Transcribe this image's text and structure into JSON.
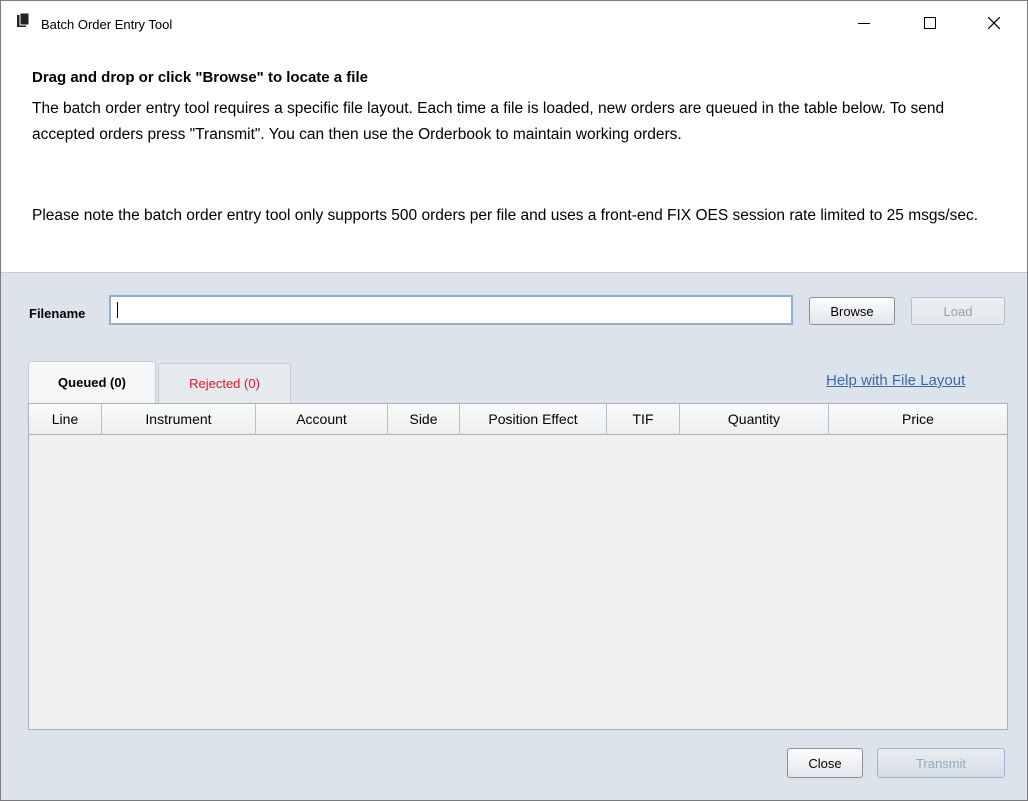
{
  "window": {
    "title": "Batch Order Entry Tool"
  },
  "intro": {
    "heading": "Drag and drop or click \"Browse\" to locate a file",
    "paragraph1": "The batch order entry tool requires a specific file layout. Each time a file is loaded, new orders are queued in the table below. To send accepted orders press \"Transmit\". You can then use the Orderbook to maintain working orders.",
    "paragraph2": "Please note the batch order entry tool only supports 500 orders per file and uses a front-end FIX OES session rate limited to 25 msgs/sec."
  },
  "file": {
    "label": "Filename",
    "value": "",
    "browse_label": "Browse",
    "load_label": "Load"
  },
  "tabs": [
    {
      "label": "Queued (0)",
      "active": true
    },
    {
      "label": "Rejected (0)",
      "active": false,
      "color": "#e0182b"
    }
  ],
  "help_link": "Help with File Layout",
  "table": {
    "columns": [
      "Line",
      "Instrument",
      "Account",
      "Side",
      "Position Effect",
      "TIF",
      "Quantity",
      "Price"
    ],
    "rows": []
  },
  "footer": {
    "close_label": "Close",
    "transmit_label": "Transmit"
  }
}
